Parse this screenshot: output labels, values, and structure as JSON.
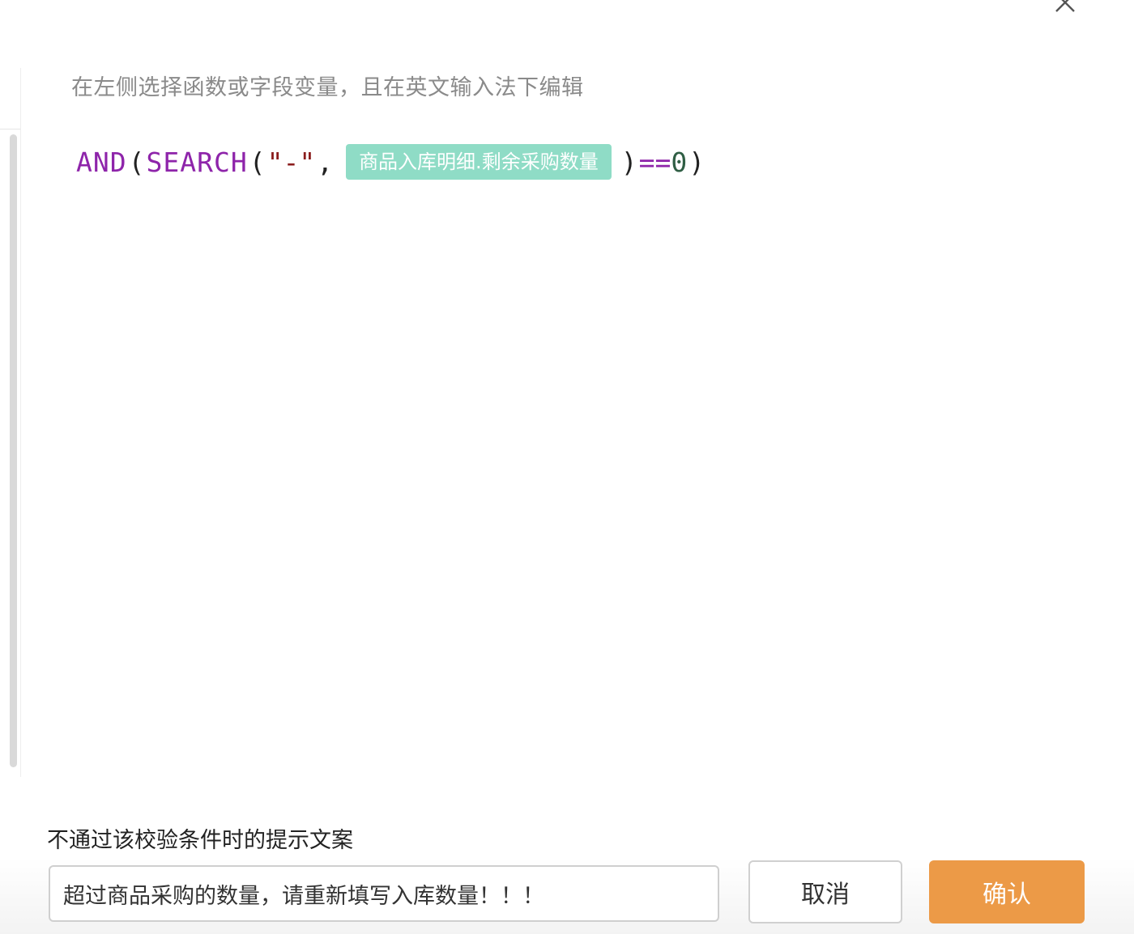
{
  "editor": {
    "hint": "在左侧选择函数或字段变量，且在英文输入法下编辑",
    "formula": {
      "fn_outer": "AND",
      "paren_open_1": "(",
      "fn_inner": "SEARCH",
      "paren_open_2": "(",
      "string_literal": "\"-\"",
      "comma": ",",
      "field_chip": "商品入库明细.剩余采购数量",
      "paren_close_1": ")",
      "operator": "==",
      "number": "0",
      "paren_close_2": ")"
    }
  },
  "footer": {
    "message_label": "不通过该校验条件时的提示文案",
    "message_value": "超过商品采购的数量，请重新填写入库数量！！！",
    "cancel_label": "取消",
    "confirm_label": "确认"
  },
  "colors": {
    "function": "#8e24aa",
    "string": "#8b1d1d",
    "number": "#2f5e44",
    "field_chip_bg": "#8fdcc6",
    "confirm_bg": "#ec9a47"
  },
  "icons": {
    "close": "close-icon"
  }
}
